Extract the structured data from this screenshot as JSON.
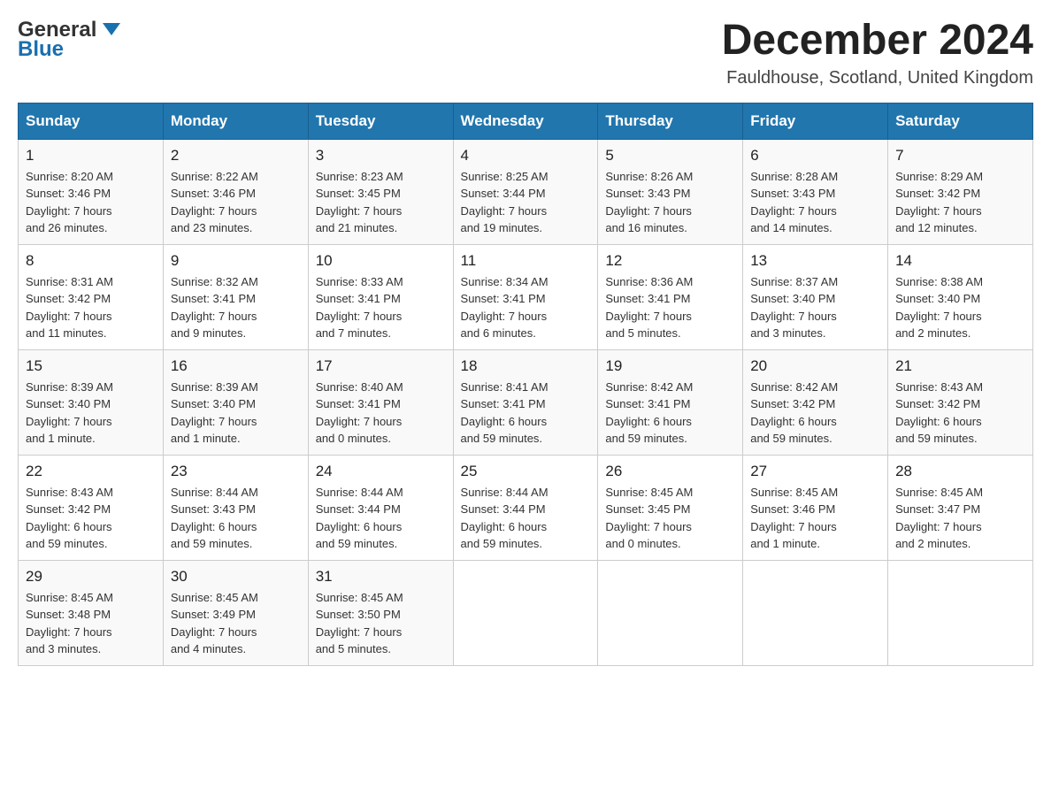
{
  "header": {
    "logo_text_general": "General",
    "logo_text_blue": "Blue",
    "month_title": "December 2024",
    "location": "Fauldhouse, Scotland, United Kingdom"
  },
  "days_of_week": [
    "Sunday",
    "Monday",
    "Tuesday",
    "Wednesday",
    "Thursday",
    "Friday",
    "Saturday"
  ],
  "weeks": [
    [
      {
        "day": "1",
        "info": "Sunrise: 8:20 AM\nSunset: 3:46 PM\nDaylight: 7 hours\nand 26 minutes."
      },
      {
        "day": "2",
        "info": "Sunrise: 8:22 AM\nSunset: 3:46 PM\nDaylight: 7 hours\nand 23 minutes."
      },
      {
        "day": "3",
        "info": "Sunrise: 8:23 AM\nSunset: 3:45 PM\nDaylight: 7 hours\nand 21 minutes."
      },
      {
        "day": "4",
        "info": "Sunrise: 8:25 AM\nSunset: 3:44 PM\nDaylight: 7 hours\nand 19 minutes."
      },
      {
        "day": "5",
        "info": "Sunrise: 8:26 AM\nSunset: 3:43 PM\nDaylight: 7 hours\nand 16 minutes."
      },
      {
        "day": "6",
        "info": "Sunrise: 8:28 AM\nSunset: 3:43 PM\nDaylight: 7 hours\nand 14 minutes."
      },
      {
        "day": "7",
        "info": "Sunrise: 8:29 AM\nSunset: 3:42 PM\nDaylight: 7 hours\nand 12 minutes."
      }
    ],
    [
      {
        "day": "8",
        "info": "Sunrise: 8:31 AM\nSunset: 3:42 PM\nDaylight: 7 hours\nand 11 minutes."
      },
      {
        "day": "9",
        "info": "Sunrise: 8:32 AM\nSunset: 3:41 PM\nDaylight: 7 hours\nand 9 minutes."
      },
      {
        "day": "10",
        "info": "Sunrise: 8:33 AM\nSunset: 3:41 PM\nDaylight: 7 hours\nand 7 minutes."
      },
      {
        "day": "11",
        "info": "Sunrise: 8:34 AM\nSunset: 3:41 PM\nDaylight: 7 hours\nand 6 minutes."
      },
      {
        "day": "12",
        "info": "Sunrise: 8:36 AM\nSunset: 3:41 PM\nDaylight: 7 hours\nand 5 minutes."
      },
      {
        "day": "13",
        "info": "Sunrise: 8:37 AM\nSunset: 3:40 PM\nDaylight: 7 hours\nand 3 minutes."
      },
      {
        "day": "14",
        "info": "Sunrise: 8:38 AM\nSunset: 3:40 PM\nDaylight: 7 hours\nand 2 minutes."
      }
    ],
    [
      {
        "day": "15",
        "info": "Sunrise: 8:39 AM\nSunset: 3:40 PM\nDaylight: 7 hours\nand 1 minute."
      },
      {
        "day": "16",
        "info": "Sunrise: 8:39 AM\nSunset: 3:40 PM\nDaylight: 7 hours\nand 1 minute."
      },
      {
        "day": "17",
        "info": "Sunrise: 8:40 AM\nSunset: 3:41 PM\nDaylight: 7 hours\nand 0 minutes."
      },
      {
        "day": "18",
        "info": "Sunrise: 8:41 AM\nSunset: 3:41 PM\nDaylight: 6 hours\nand 59 minutes."
      },
      {
        "day": "19",
        "info": "Sunrise: 8:42 AM\nSunset: 3:41 PM\nDaylight: 6 hours\nand 59 minutes."
      },
      {
        "day": "20",
        "info": "Sunrise: 8:42 AM\nSunset: 3:42 PM\nDaylight: 6 hours\nand 59 minutes."
      },
      {
        "day": "21",
        "info": "Sunrise: 8:43 AM\nSunset: 3:42 PM\nDaylight: 6 hours\nand 59 minutes."
      }
    ],
    [
      {
        "day": "22",
        "info": "Sunrise: 8:43 AM\nSunset: 3:42 PM\nDaylight: 6 hours\nand 59 minutes."
      },
      {
        "day": "23",
        "info": "Sunrise: 8:44 AM\nSunset: 3:43 PM\nDaylight: 6 hours\nand 59 minutes."
      },
      {
        "day": "24",
        "info": "Sunrise: 8:44 AM\nSunset: 3:44 PM\nDaylight: 6 hours\nand 59 minutes."
      },
      {
        "day": "25",
        "info": "Sunrise: 8:44 AM\nSunset: 3:44 PM\nDaylight: 6 hours\nand 59 minutes."
      },
      {
        "day": "26",
        "info": "Sunrise: 8:45 AM\nSunset: 3:45 PM\nDaylight: 7 hours\nand 0 minutes."
      },
      {
        "day": "27",
        "info": "Sunrise: 8:45 AM\nSunset: 3:46 PM\nDaylight: 7 hours\nand 1 minute."
      },
      {
        "day": "28",
        "info": "Sunrise: 8:45 AM\nSunset: 3:47 PM\nDaylight: 7 hours\nand 2 minutes."
      }
    ],
    [
      {
        "day": "29",
        "info": "Sunrise: 8:45 AM\nSunset: 3:48 PM\nDaylight: 7 hours\nand 3 minutes."
      },
      {
        "day": "30",
        "info": "Sunrise: 8:45 AM\nSunset: 3:49 PM\nDaylight: 7 hours\nand 4 minutes."
      },
      {
        "day": "31",
        "info": "Sunrise: 8:45 AM\nSunset: 3:50 PM\nDaylight: 7 hours\nand 5 minutes."
      },
      {
        "day": "",
        "info": ""
      },
      {
        "day": "",
        "info": ""
      },
      {
        "day": "",
        "info": ""
      },
      {
        "day": "",
        "info": ""
      }
    ]
  ]
}
